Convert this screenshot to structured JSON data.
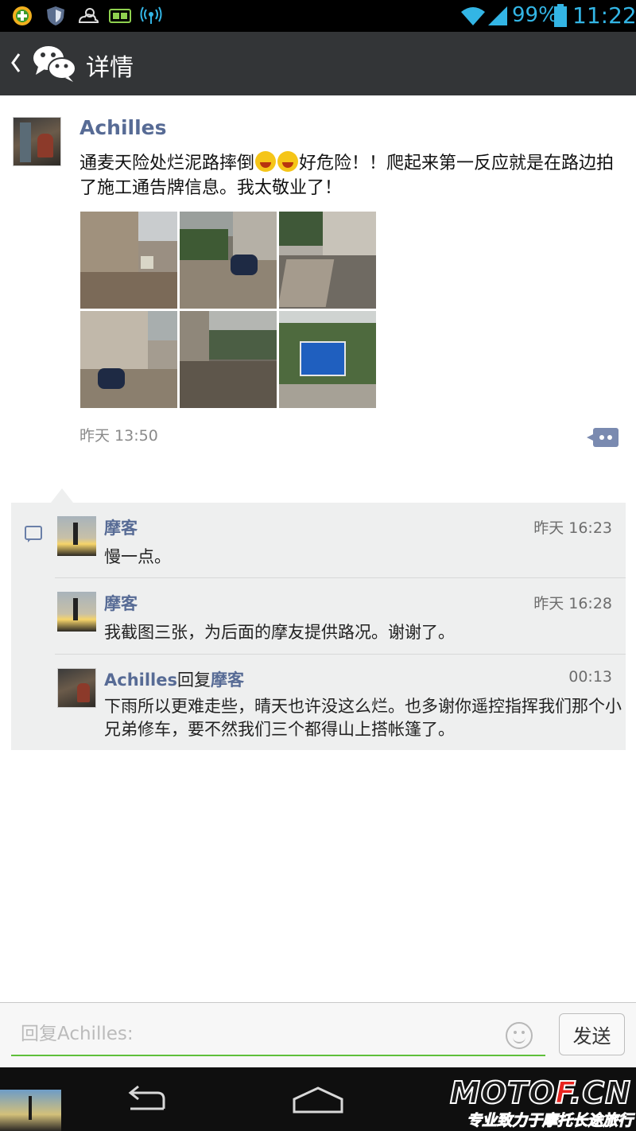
{
  "status_bar": {
    "battery_percent": "99%",
    "time": "11:22",
    "icons": [
      "plus-circle-icon",
      "shield-icon",
      "weather-icon",
      "battery-app-icon",
      "wireless-signal-icon",
      "wifi-icon",
      "cell-signal-icon",
      "battery-icon"
    ]
  },
  "action_bar": {
    "title": "详情",
    "back_icon": "chevron-left-icon",
    "logo_icon": "wechat-logo-icon"
  },
  "post": {
    "author": "Achilles",
    "text_before_emoji": "通麦天险处烂泥路摔倒",
    "text_after_emoji": "好危险！！爬起来第一反应就是在路边拍了施工通告牌信息。我太敬业了！",
    "emoji_count": 2,
    "photo_count": 6,
    "time": "昨天 13:50"
  },
  "comments": [
    {
      "author": "摩客",
      "time": "昨天 16:23",
      "text": "慢一点。"
    },
    {
      "author": "摩客",
      "time": "昨天 16:28",
      "text": "我截图三张，为后面的摩友提供路况。谢谢了。"
    },
    {
      "author": "Achilles",
      "reply_word": "回复",
      "reply_to": "摩客",
      "time": "00:13",
      "text": "下雨所以更难走些，晴天也许没这么烂。也多谢你遥控指挥我们那个小兄弟修车，要不然我们三个都得山上搭帐篷了。"
    }
  ],
  "reply_bar": {
    "placeholder": "回复Achilles:",
    "send_label": "发送"
  },
  "watermark": {
    "logo_main": "MOTO",
    "logo_accent": "F",
    "logo_suffix": ".CN",
    "slogan": "专业致力于摩托长途旅行"
  },
  "colors": {
    "link_blue": "#576b95",
    "status_blue": "#33b5e5",
    "action_bar": "#333537",
    "input_underline": "#5fbf3a",
    "comment_bg": "#eeefef"
  }
}
